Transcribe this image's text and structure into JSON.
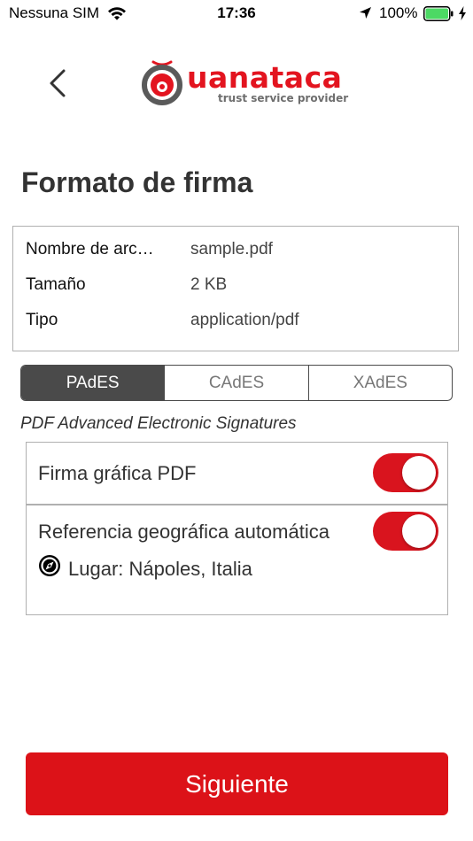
{
  "status_bar": {
    "carrier": "Nessuna SIM",
    "time": "17:36",
    "battery_percent": "100%",
    "battery_level": 1.0,
    "battery_color": "#4cd964"
  },
  "nav": {
    "back_icon": "chevron-left-icon",
    "logo": {
      "wordmark": "uanataca",
      "tagline": "trust service provider",
      "brand_color": "#e3141f"
    }
  },
  "page_title": "Formato de firma",
  "file_info": [
    {
      "label": "Nombre de archivo",
      "value": "sample.pdf"
    },
    {
      "label": "Tamaño",
      "value": "2 KB"
    },
    {
      "label": "Tipo",
      "value": "application/pdf"
    }
  ],
  "format_tabs": {
    "selected": "PAdES",
    "items": [
      {
        "label": "PAdES"
      },
      {
        "label": "CAdES"
      },
      {
        "label": "XAdES"
      }
    ]
  },
  "format_description": "PDF Advanced Electronic Signatures",
  "options": {
    "graphic_signature": {
      "label": "Firma gráfica PDF",
      "enabled": true
    },
    "geo_reference": {
      "label": "Referencia geográfica automática",
      "enabled": true,
      "place": "Lugar: Nápoles, Italia",
      "place_icon": "compass-icon"
    }
  },
  "toggle_on_color": "#d9141e",
  "next_button_label": "Siguiente",
  "next_button_color": "#dc1218"
}
